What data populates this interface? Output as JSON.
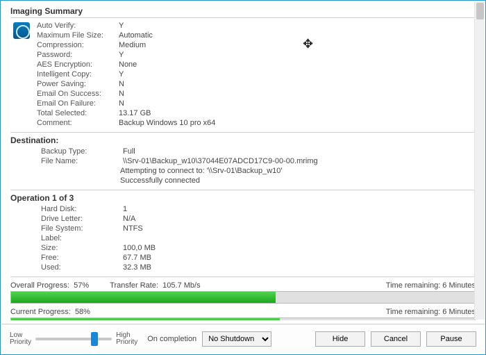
{
  "sections": {
    "imaging_title": "Imaging Summary",
    "destination_title": "Destination:",
    "operation_title": "Operation 1 of 3"
  },
  "summary": {
    "auto_verify_k": "Auto Verify:",
    "auto_verify_v": "Y",
    "max_file_k": "Maximum File Size:",
    "max_file_v": "Automatic",
    "compression_k": "Compression:",
    "compression_v": "Medium",
    "password_k": "Password:",
    "password_v": "Y",
    "aes_k": "AES Encryption:",
    "aes_v": "None",
    "intelligent_k": "Intelligent Copy:",
    "intelligent_v": "Y",
    "power_k": "Power Saving:",
    "power_v": "N",
    "email_succ_k": "Email On Success:",
    "email_succ_v": "N",
    "email_fail_k": "Email On Failure:",
    "email_fail_v": "N",
    "total_sel_k": "Total Selected:",
    "total_sel_v": "13.17 GB",
    "comment_k": "Comment:",
    "comment_v": "Backup Windows 10 pro x64"
  },
  "destination": {
    "type_k": "Backup Type:",
    "type_v": "Full",
    "file_k": "File Name:",
    "file_v": "\\\\Srv-01\\Backup_w10\\37044E07ADCD17C9-00-00.mrimg",
    "attempt": "Attempting to connect to: '\\\\Srv-01\\Backup_w10'",
    "success": "Successfully connected"
  },
  "operation": {
    "disk_k": "Hard Disk:",
    "disk_v": "1",
    "letter_k": "Drive Letter:",
    "letter_v": "N/A",
    "fs_k": "File System:",
    "fs_v": "NTFS",
    "label_k": "Label:",
    "label_v": "",
    "size_k": "Size:",
    "size_v": "100,0 MB",
    "free_k": "Free:",
    "free_v": "67.7 MB",
    "used_k": "Used:",
    "used_v": "32.3 MB"
  },
  "progress": {
    "overall_label": "Overall Progress:",
    "overall_pct_text": "57%",
    "overall_pct": 57,
    "rate_label": "Transfer Rate:",
    "rate_value": "105.7 Mb/s",
    "overall_remaining": "Time remaining: 6 Minutes",
    "current_label": "Current Progress:",
    "current_pct_text": "58%",
    "current_pct": 58,
    "current_remaining": "Time remaining: 6 Minutes"
  },
  "footer": {
    "low_prio": "Low",
    "priority_word": "Priority",
    "high_prio": "High",
    "on_completion": "On completion",
    "shutdown_option": "No Shutdown",
    "hide": "Hide",
    "cancel": "Cancel",
    "pause": "Pause"
  }
}
